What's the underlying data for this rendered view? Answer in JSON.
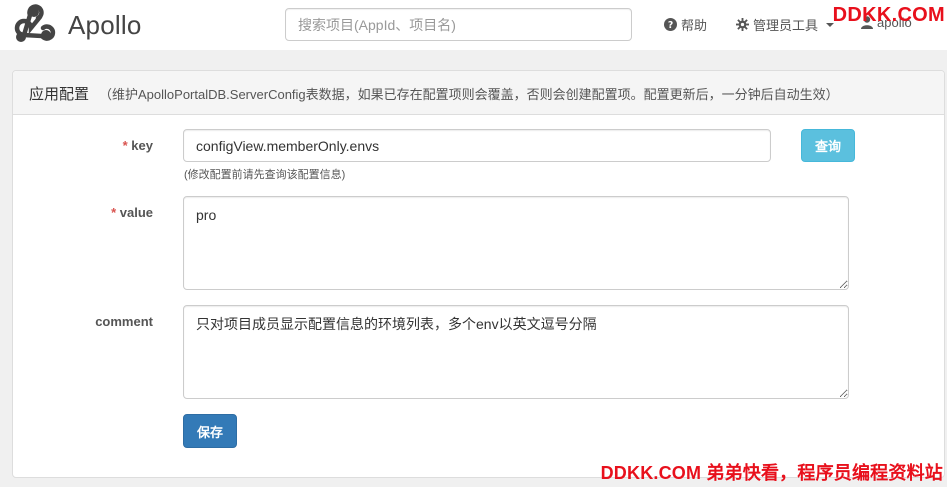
{
  "navbar": {
    "brand": "Apollo",
    "search_placeholder": "搜索项目(AppId、项目名)",
    "help_label": "帮助",
    "admin_tools_label": "管理员工具",
    "user_label": "apollo"
  },
  "panel": {
    "title": "应用配置",
    "description": "（维护ApolloPortalDB.ServerConfig表数据，如果已存在配置项则会覆盖，否则会创建配置项。配置更新后，一分钟后自动生效）"
  },
  "form": {
    "required_mark": "*",
    "key_label": "key",
    "key_value": "configView.memberOnly.envs",
    "key_help": "(修改配置前请先查询该配置信息)",
    "query_button": "查询",
    "value_label": "value",
    "value_value": "pro",
    "comment_label": "comment",
    "comment_value": "只对项目成员显示配置信息的环境列表，多个env以英文逗号分隔",
    "save_button": "保存"
  },
  "watermarks": {
    "top": "DDKK.COM",
    "bottom": "DDKK.COM 弟弟快看，程序员编程资料站"
  },
  "colors": {
    "accent_query": "#5bc0de",
    "accent_save": "#337ab7",
    "required": "#d9534f",
    "watermark": "#e8101c"
  },
  "icons": {
    "logo": "apollo-logo-icon",
    "help": "question-circle-icon",
    "admin": "gear-icon",
    "user": "user-icon"
  }
}
